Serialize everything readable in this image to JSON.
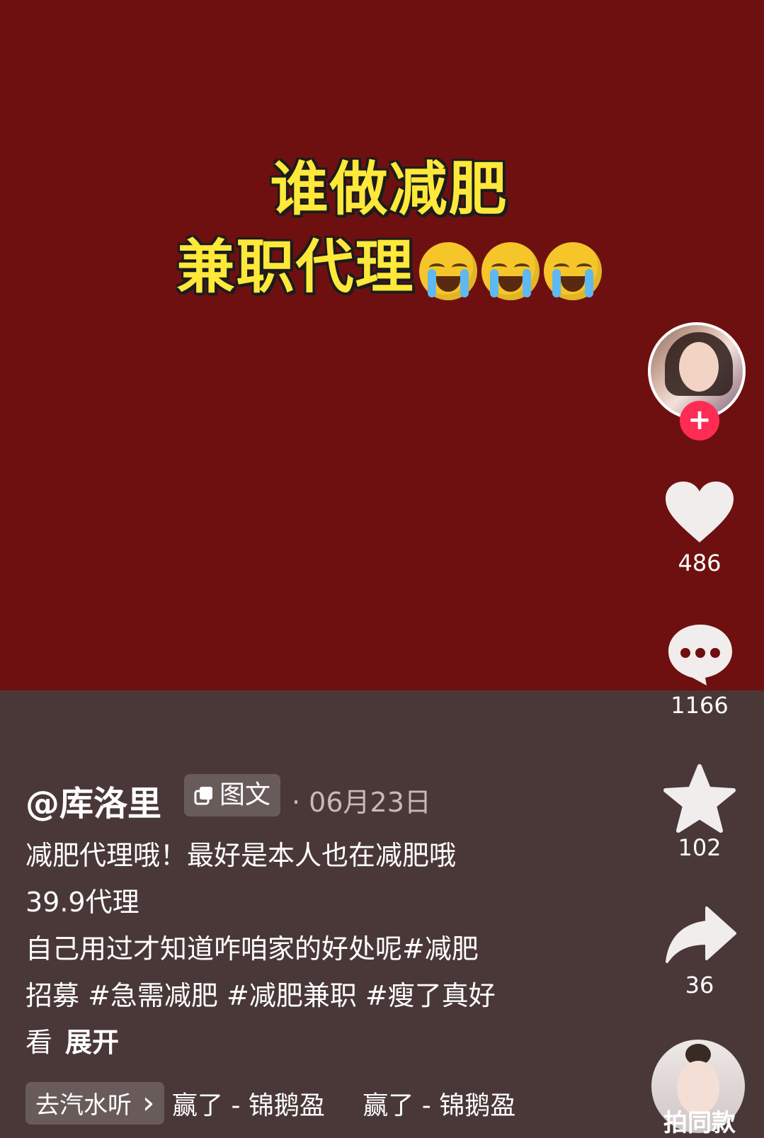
{
  "video": {
    "headline_line1": "谁做减肥",
    "headline_line2": "兼职代理",
    "emoji_icon": "loudly-crying-face-icon"
  },
  "actions": {
    "likes": "486",
    "comments": "1166",
    "favorites": "102",
    "shares": "36",
    "follow_symbol": "+"
  },
  "post": {
    "author": "@库洛里",
    "type_label": "图文",
    "date": "· 06月23日",
    "desc_lines": [
      "减肥代理哦！最好是本人也在减肥哦",
      "39.9代理",
      "自己用过才知道咋咱家的好处呢#减肥",
      "招募 #急需减肥 #减肥兼职 #瘦了真好",
      "看"
    ],
    "expand_label": "展开"
  },
  "music": {
    "chip_label": "去汽水听",
    "chip_arrow": "›",
    "track_1": "赢了 - 锦鹅盈",
    "track_2": "赢了 - 锦鹅盈",
    "same_style_label": "拍同款"
  },
  "colors": {
    "video_bg": "#6e1010",
    "info_bg": "#4a3838",
    "headline": "#ffe83a",
    "follow": "#fe2c55"
  }
}
